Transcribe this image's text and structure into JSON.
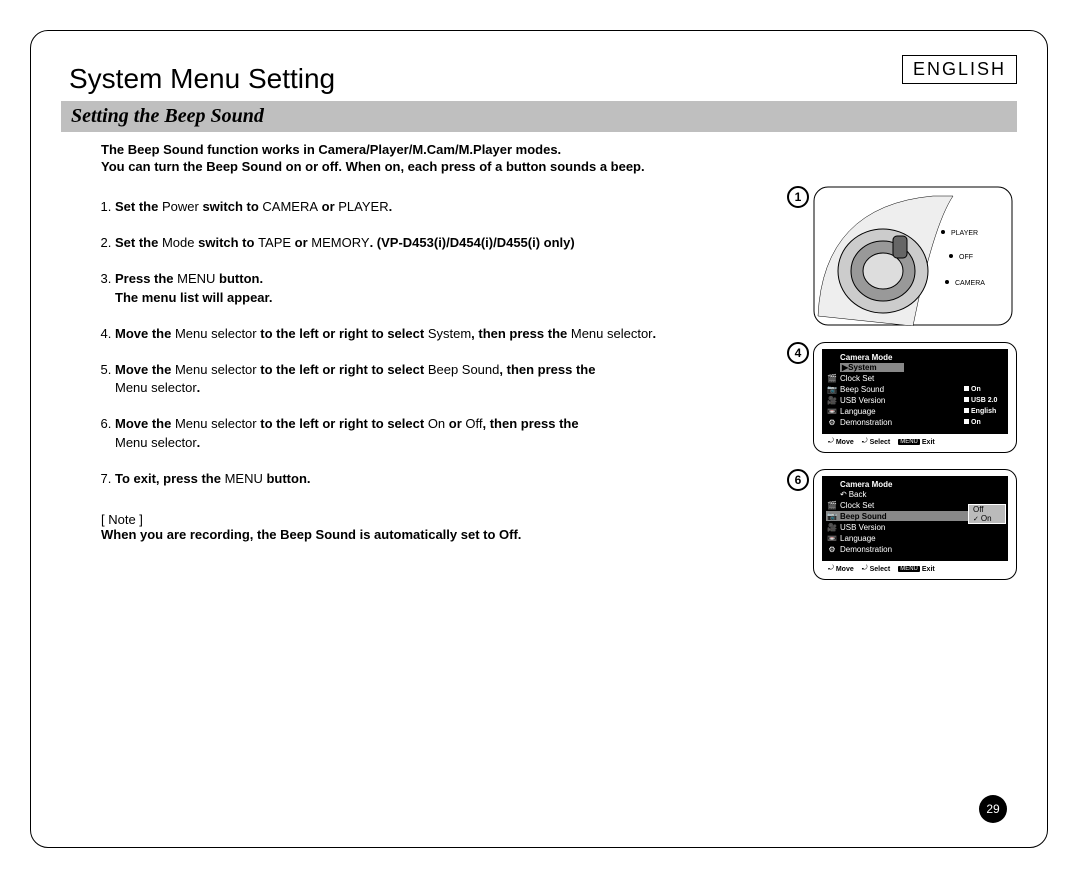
{
  "header": {
    "language": "ENGLISH",
    "title": "System Menu Setting",
    "section": "Setting the Beep Sound"
  },
  "intro": {
    "line1": "The Beep Sound function works in Camera/Player/M.Cam/M.Player modes.",
    "line2": "You can turn the Beep Sound on or off. When on, each press of a button sounds a beep."
  },
  "steps": {
    "s1": {
      "pre": "Set the ",
      "mid": "Power",
      "post": " switch to ",
      "opt": "CAMERA",
      "or": " or ",
      "opt2": "PLAYER",
      "end": "."
    },
    "s2": {
      "pre": "Set the ",
      "mid": "Mode",
      "post": " switch to ",
      "opt": "TAPE",
      "or": " or ",
      "opt2": "MEMORY",
      "end": ". (VP-D453(i)/D454(i)/D455(i) only)"
    },
    "s3a": "Press the ",
    "s3b": "MENU",
    "s3c": " button.",
    "s3d": "The menu list will appear.",
    "s4a": "Move the ",
    "s4b": "Menu selector ",
    "s4c": " to the left or right to select ",
    "s4d": "System",
    "s4e": ", then press the ",
    "s4f": "Menu selector",
    "s4g": ".",
    "s5a": "Move the ",
    "s5b": "Menu selector ",
    "s5c": " to the left or right to select ",
    "s5d": "Beep Sound",
    "s5e": ", then press the ",
    "s5f": "Menu selector",
    "s5g": ".",
    "s6a": "Move the ",
    "s6b": "Menu selector ",
    "s6c": " to the left or right to select ",
    "s6d": "On",
    "s6e": " or ",
    "s6f": "Off",
    "s6g": ", then press the ",
    "s6h": "Menu selector",
    "s6i": ".",
    "s7a": "To exit, press the ",
    "s7b": "MENU",
    "s7c": " button."
  },
  "note": {
    "label": "[ Note ]",
    "text": "When you are recording, the Beep Sound is automatically set to Off."
  },
  "figs": {
    "num1": "1",
    "num4": "4",
    "num6": "6",
    "switch": {
      "player": "PLAYER",
      "off": "OFF",
      "camera": "CAMERA"
    },
    "menu4": {
      "mode": "Camera Mode",
      "system": "System",
      "rows": [
        {
          "label": "Clock Set",
          "val": ""
        },
        {
          "label": "Beep Sound",
          "val": "On"
        },
        {
          "label": "USB Version",
          "val": "USB 2.0"
        },
        {
          "label": "Language",
          "val": "English"
        },
        {
          "label": "Demonstration",
          "val": "On"
        }
      ],
      "move": "Move",
      "select": "Select",
      "exit": "Exit",
      "menu": "MENU"
    },
    "menu6": {
      "mode": "Camera Mode",
      "back": "Back",
      "rows": [
        {
          "label": "Clock Set",
          "val": ""
        },
        {
          "label": "Beep Sound",
          "val": "Off",
          "hl": true
        },
        {
          "label": "USB Version",
          "val": ""
        },
        {
          "label": "Language",
          "val": ""
        },
        {
          "label": "Demonstration",
          "val": ""
        }
      ],
      "opt_on": "On",
      "opt_off": "Off",
      "move": "Move",
      "select": "Select",
      "exit": "Exit",
      "menu": "MENU"
    }
  },
  "page_number": "29"
}
